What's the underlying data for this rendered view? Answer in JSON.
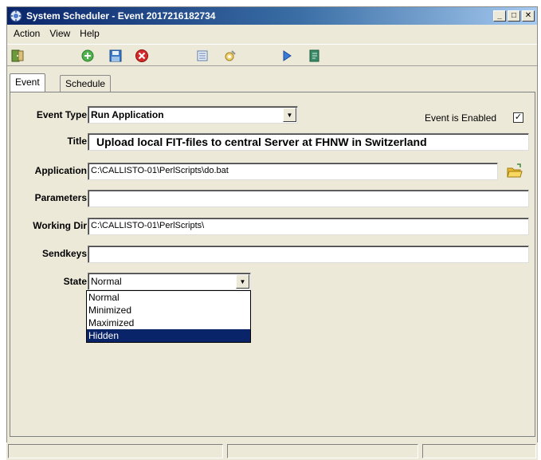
{
  "window": {
    "title": "System Scheduler - Event 2017216182734",
    "min_glyph": "_",
    "max_glyph": "□",
    "close_glyph": "✕"
  },
  "menu": [
    "Action",
    "View",
    "Help"
  ],
  "toolbar_icons": [
    "exit-icon",
    "add-icon",
    "save-icon",
    "delete-icon",
    "list-icon",
    "settings-icon",
    "run-icon",
    "document-icon"
  ],
  "tabs": [
    {
      "label": "Event",
      "active": true
    },
    {
      "label": "Schedule",
      "active": false
    }
  ],
  "form": {
    "event_type_label": "Event Type",
    "event_type_value": "Run Application",
    "enabled_label": "Event is Enabled",
    "enabled_mark": "✓",
    "title_label": "Title",
    "title_value": "Upload local FIT-files to central Server at FHNW in Switzerland",
    "application_label": "Application",
    "application_value": "C:\\CALLISTO-01\\PerlScripts\\do.bat",
    "parameters_label": "Parameters",
    "parameters_value": "",
    "working_dir_label": "Working Dir",
    "working_dir_value": "C:\\CALLISTO-01\\PerlScripts\\",
    "sendkeys_label": "Sendkeys",
    "sendkeys_value": "",
    "state_label": "State",
    "state_value": "Normal",
    "state_options": [
      "Normal",
      "Minimized",
      "Maximized",
      "Hidden"
    ],
    "state_highlighted": "Hidden",
    "dropdown_arrow": "▼"
  },
  "colors": {
    "titlebar_start": "#0a246a",
    "selection": "#0a246a",
    "window_bg": "#ece9d8"
  }
}
